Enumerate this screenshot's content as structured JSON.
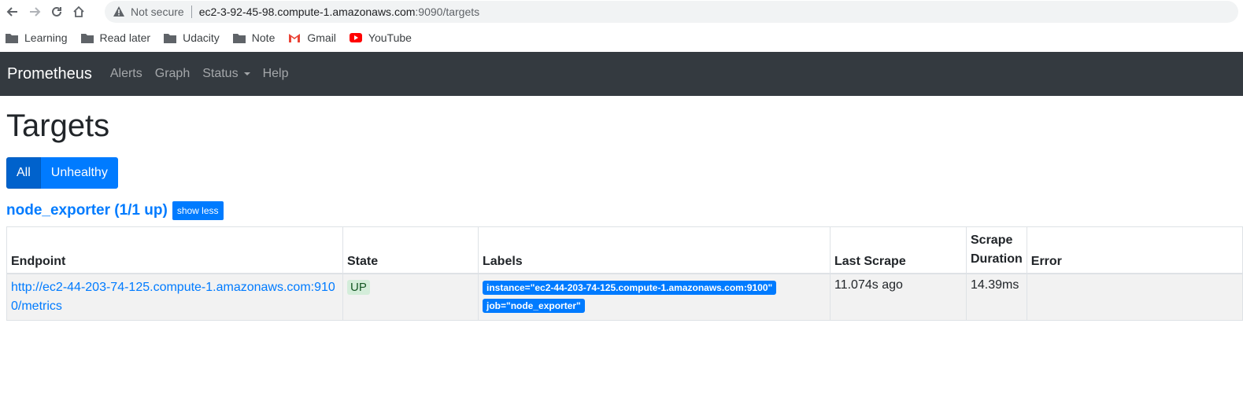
{
  "browser": {
    "not_secure": "Not secure",
    "url_host": "ec2-3-92-45-98.compute-1.amazonaws.com",
    "url_path": ":9090/targets",
    "bookmarks": [
      {
        "label": "Learning",
        "icon": "folder-icon"
      },
      {
        "label": "Read later",
        "icon": "folder-icon"
      },
      {
        "label": "Udacity",
        "icon": "folder-icon"
      },
      {
        "label": "Note",
        "icon": "folder-icon"
      },
      {
        "label": "Gmail",
        "icon": "gmail-icon"
      },
      {
        "label": "YouTube",
        "icon": "youtube-icon"
      }
    ]
  },
  "navbar": {
    "brand": "Prometheus",
    "links": [
      "Alerts",
      "Graph",
      "Status",
      "Help"
    ]
  },
  "page": {
    "title": "Targets",
    "filter_all": "All",
    "filter_unhealthy": "Unhealthy"
  },
  "job": {
    "title": "node_exporter (1/1 up)",
    "toggle": "show less",
    "headers": {
      "endpoint": "Endpoint",
      "state": "State",
      "labels": "Labels",
      "last_scrape": "Last Scrape",
      "scrape_duration": "Scrape Duration",
      "error": "Error"
    },
    "rows": [
      {
        "endpoint": "http://ec2-44-203-74-125.compute-1.amazonaws.com:9100/metrics",
        "state": "UP",
        "label_instance": "instance=\"ec2-44-203-74-125.compute-1.amazonaws.com:9100\"",
        "label_job": "job=\"node_exporter\"",
        "last_scrape": "11.074s ago",
        "scrape_duration": "14.39ms",
        "error": ""
      }
    ]
  },
  "colors": {
    "navbar_bg": "#343a40",
    "primary": "#007bff",
    "up_bg": "#d4edda"
  }
}
